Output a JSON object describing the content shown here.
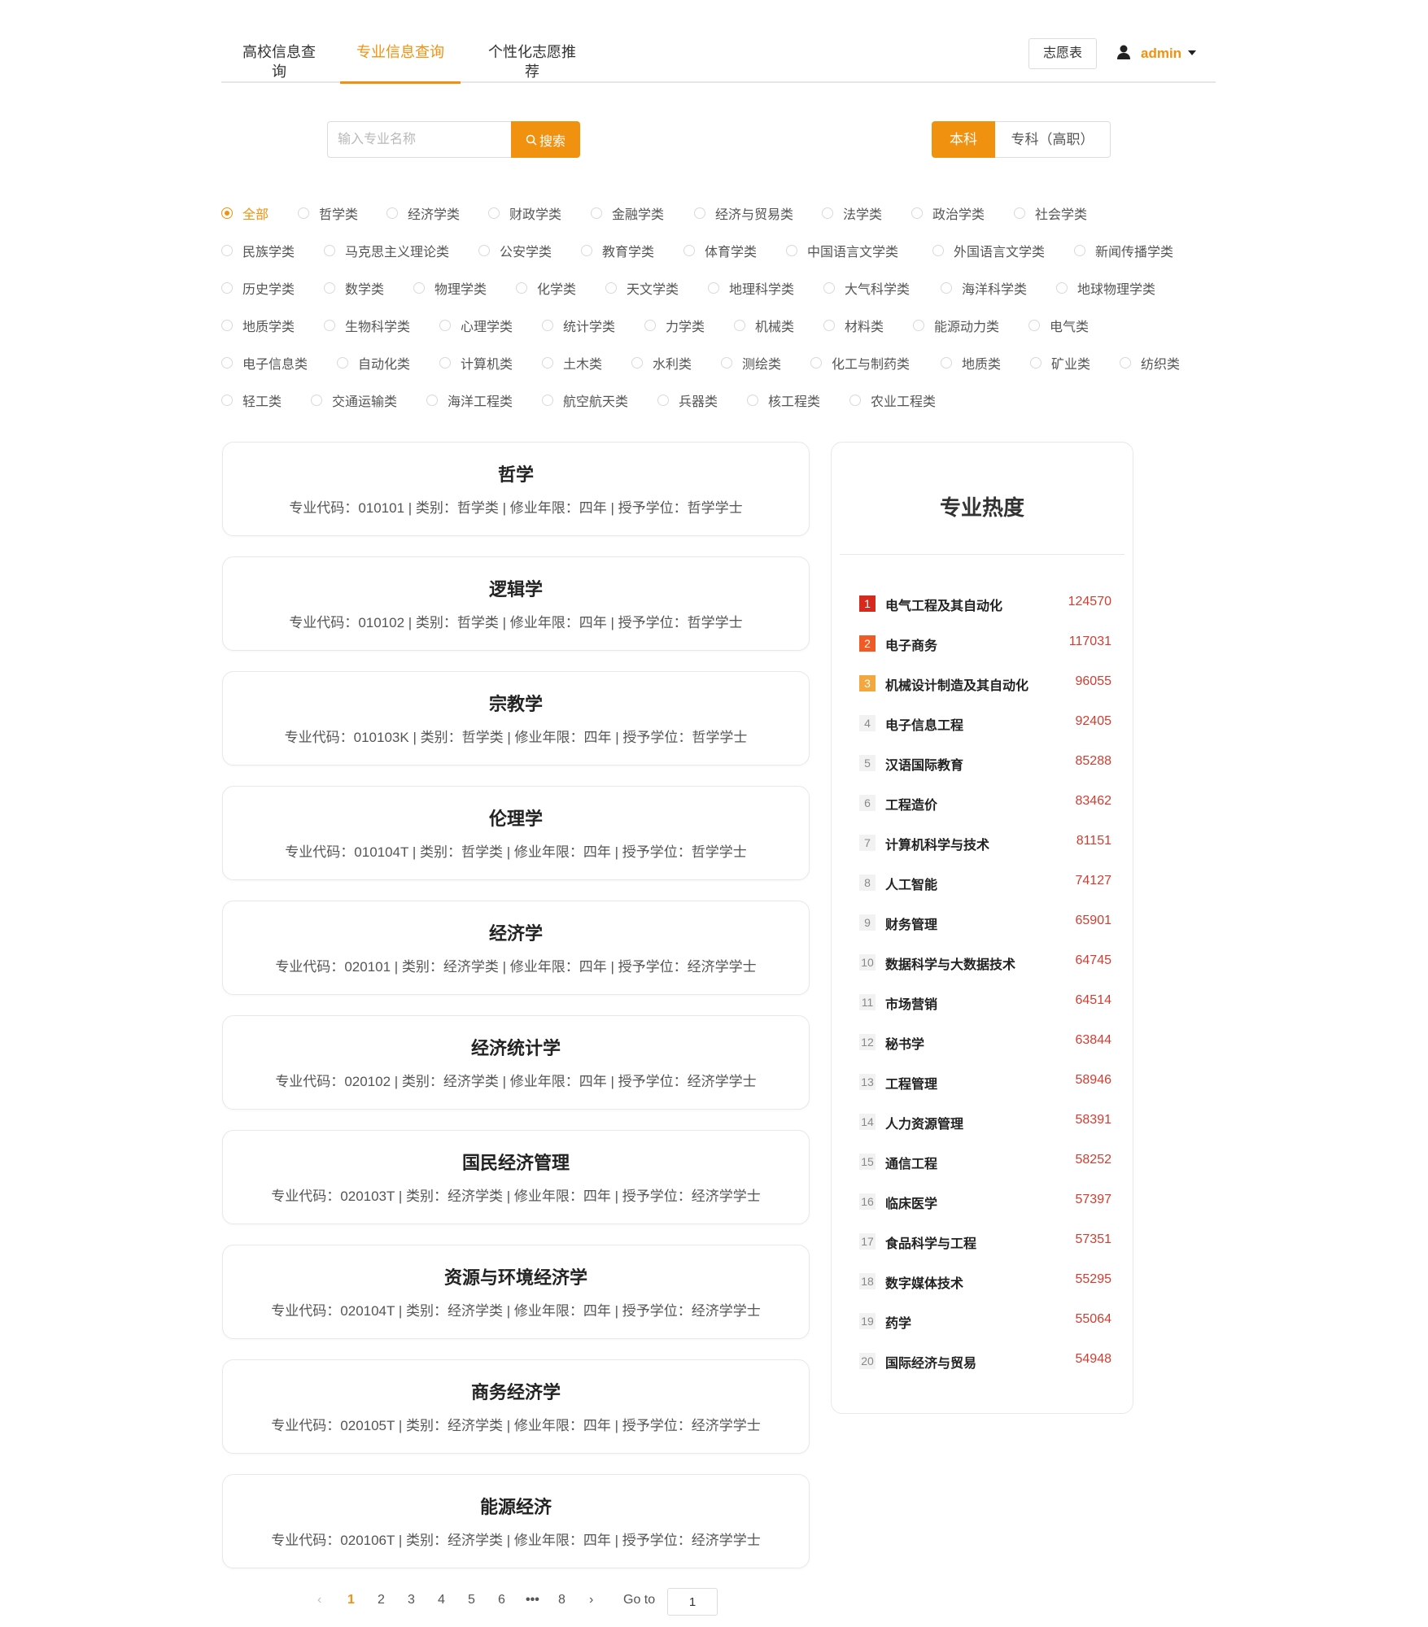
{
  "nav": {
    "tabs": [
      {
        "label": "高校信息查询"
      },
      {
        "label": "专业信息查询"
      },
      {
        "label": "个性化志愿推荐"
      }
    ],
    "wish_button": "志愿表",
    "user_name": "admin",
    "accent_color": "#f0920f"
  },
  "search": {
    "placeholder": "输入专业名称",
    "value": "",
    "button_label": "搜索"
  },
  "level": {
    "options": [
      "本科",
      "专科（高职）"
    ],
    "selected": "本科"
  },
  "categories": {
    "selected": "全部",
    "rows": [
      [
        "全部",
        "哲学类",
        "经济学类",
        "财政学类",
        "金融学类",
        "经济与贸易类",
        "法学类",
        "政治学类",
        "社会学类"
      ],
      [
        "民族学类",
        "马克思主义理论类",
        "公安学类",
        "教育学类",
        "体育学类",
        "中国语言文学类",
        "外国语言文学类",
        "新闻传播学类"
      ],
      [
        "历史学类",
        "数学类",
        "物理学类",
        "化学类",
        "天文学类",
        "地理科学类",
        "大气科学类",
        "海洋科学类",
        "地球物理学类"
      ],
      [
        "地质学类",
        "生物科学类",
        "心理学类",
        "统计学类",
        "力学类",
        "机械类",
        "材料类",
        "能源动力类",
        "电气类"
      ],
      [
        "电子信息类",
        "自动化类",
        "计算机类",
        "土木类",
        "水利类",
        "测绘类",
        "化工与制药类",
        "地质类",
        "矿业类",
        "纺织类"
      ],
      [
        "轻工类",
        "交通运输类",
        "海洋工程类",
        "航空航天类",
        "兵器类",
        "核工程类",
        "农业工程类"
      ]
    ]
  },
  "labels": {
    "code": "专业代码：",
    "category": "类别：",
    "years": "修业年限：",
    "degree": "授予学位："
  },
  "majors": [
    {
      "name": "哲学",
      "code": "010101",
      "category": "哲学类",
      "years": "四年",
      "degree": "哲学学士"
    },
    {
      "name": "逻辑学",
      "code": "010102",
      "category": "哲学类",
      "years": "四年",
      "degree": "哲学学士"
    },
    {
      "name": "宗教学",
      "code": "010103K",
      "category": "哲学类",
      "years": "四年",
      "degree": "哲学学士"
    },
    {
      "name": "伦理学",
      "code": "010104T",
      "category": "哲学类",
      "years": "四年",
      "degree": "哲学学士"
    },
    {
      "name": "经济学",
      "code": "020101",
      "category": "经济学类",
      "years": "四年",
      "degree": "经济学学士"
    },
    {
      "name": "经济统计学",
      "code": "020102",
      "category": "经济学类",
      "years": "四年",
      "degree": "经济学学士"
    },
    {
      "name": "国民经济管理",
      "code": "020103T",
      "category": "经济学类",
      "years": "四年",
      "degree": "经济学学士"
    },
    {
      "name": "资源与环境经济学",
      "code": "020104T",
      "category": "经济学类",
      "years": "四年",
      "degree": "经济学学士"
    },
    {
      "name": "商务经济学",
      "code": "020105T",
      "category": "经济学类",
      "years": "四年",
      "degree": "经济学学士"
    },
    {
      "name": "能源经济",
      "code": "020106T",
      "category": "经济学类",
      "years": "四年",
      "degree": "经济学学士"
    }
  ],
  "hot": {
    "title": "专业热度",
    "items": [
      {
        "rank": "1",
        "name": "电气工程及其自动化",
        "count": "124570"
      },
      {
        "rank": "2",
        "name": "电子商务",
        "count": "117031"
      },
      {
        "rank": "3",
        "name": "机械设计制造及其自动化",
        "count": "96055"
      },
      {
        "rank": "4",
        "name": "电子信息工程",
        "count": "92405"
      },
      {
        "rank": "5",
        "name": "汉语国际教育",
        "count": "85288"
      },
      {
        "rank": "6",
        "name": "工程造价",
        "count": "83462"
      },
      {
        "rank": "7",
        "name": "计算机科学与技术",
        "count": "81151"
      },
      {
        "rank": "8",
        "name": "人工智能",
        "count": "74127"
      },
      {
        "rank": "9",
        "name": "财务管理",
        "count": "65901"
      },
      {
        "rank": "10",
        "name": "数据科学与大数据技术",
        "count": "64745"
      },
      {
        "rank": "11",
        "name": "市场营销",
        "count": "64514"
      },
      {
        "rank": "12",
        "name": "秘书学",
        "count": "63844"
      },
      {
        "rank": "13",
        "name": "工程管理",
        "count": "58946"
      },
      {
        "rank": "14",
        "name": "人力资源管理",
        "count": "58391"
      },
      {
        "rank": "15",
        "name": "通信工程",
        "count": "58252"
      },
      {
        "rank": "16",
        "name": "临床医学",
        "count": "57397"
      },
      {
        "rank": "17",
        "name": "食品科学与工程",
        "count": "57351"
      },
      {
        "rank": "18",
        "name": "数字媒体技术",
        "count": "55295"
      },
      {
        "rank": "19",
        "name": "药学",
        "count": "55064"
      },
      {
        "rank": "20",
        "name": "国际经济与贸易",
        "count": "54948"
      }
    ]
  },
  "pagination": {
    "prev_icon": "‹",
    "next_icon": "›",
    "pages": [
      "1",
      "2",
      "3",
      "4",
      "5",
      "6",
      "•••",
      "8"
    ],
    "current": "1",
    "goto_label": "Go to",
    "goto_value": "1"
  }
}
